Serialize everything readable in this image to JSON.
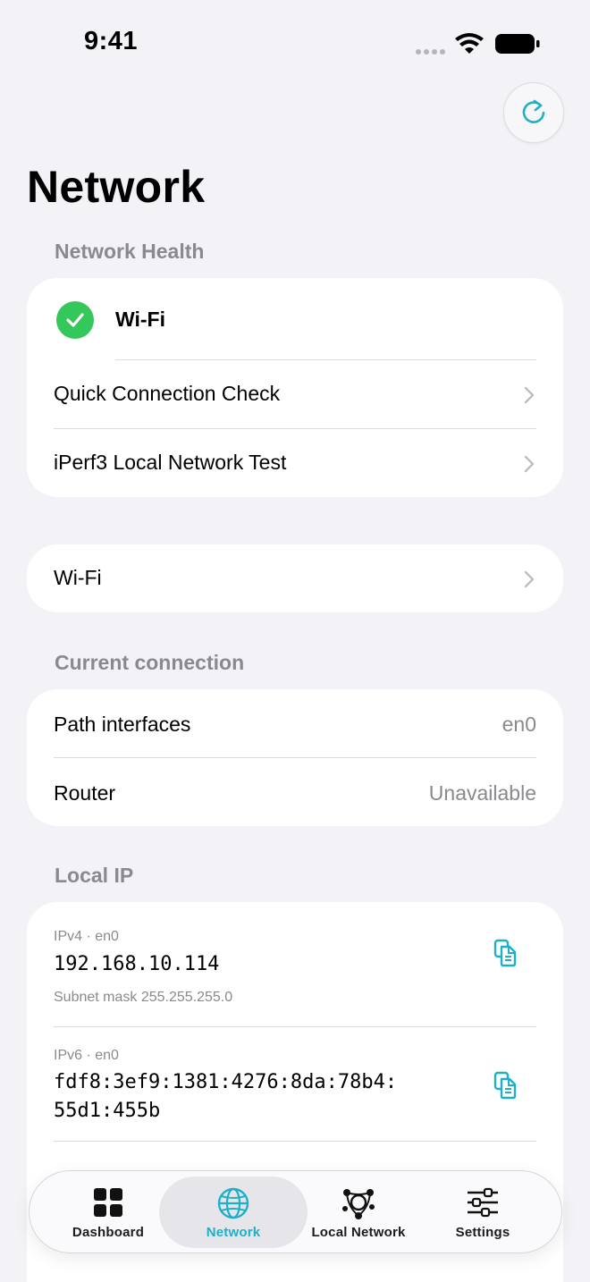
{
  "status": {
    "time": "9:41"
  },
  "page": {
    "title": "Network"
  },
  "network_health": {
    "header": "Network Health",
    "wifi_label": "Wi-Fi",
    "rows": [
      "Quick Connection Check",
      "iPerf3 Local Network Test"
    ]
  },
  "wifi_card": {
    "label": "Wi-Fi"
  },
  "current_connection": {
    "header": "Current connection",
    "rows": [
      {
        "label": "Path interfaces",
        "value": "en0"
      },
      {
        "label": "Router",
        "value": "Unavailable"
      }
    ]
  },
  "local_ip": {
    "header": "Local IP",
    "entries": [
      {
        "type": "IPv4 · en0",
        "address": "192.168.10.114",
        "subnet": "Subnet mask 255.255.255.0"
      },
      {
        "type": "IPv6 · en0",
        "address_line1": "fdf8:3ef9:1381:4276:8da:78b4:",
        "address_line2": "55d1:455b"
      }
    ]
  },
  "tabs": [
    {
      "label": "Dashboard",
      "icon": "grid-icon",
      "active": false
    },
    {
      "label": "Network",
      "icon": "globe-icon",
      "active": true
    },
    {
      "label": "Local Network",
      "icon": "network-nodes-icon",
      "active": false
    },
    {
      "label": "Settings",
      "icon": "sliders-icon",
      "active": false
    }
  ],
  "colors": {
    "accent": "#1DB0C8",
    "success": "#34C759",
    "background": "#F2F2F7"
  }
}
